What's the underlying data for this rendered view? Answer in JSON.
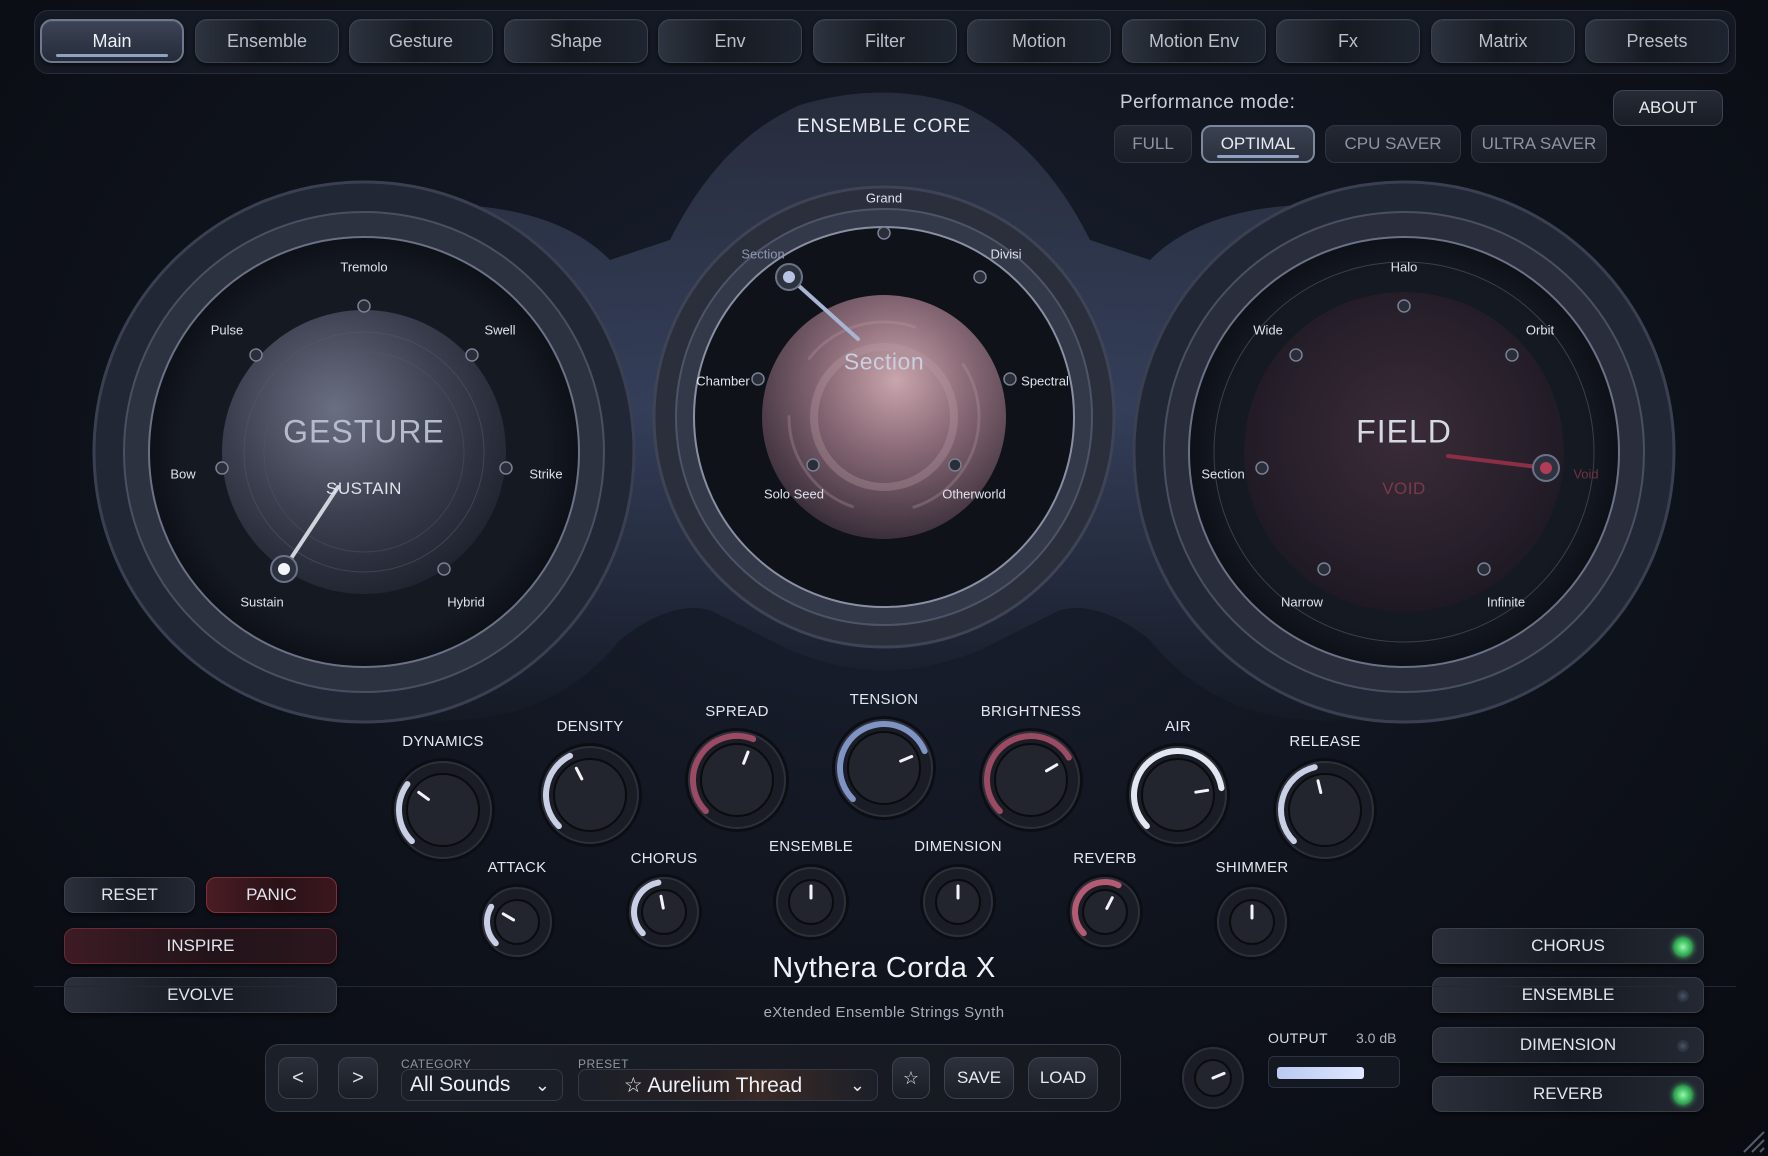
{
  "tabs": [
    "Main",
    "Ensemble",
    "Gesture",
    "Shape",
    "Env",
    "Filter",
    "Motion",
    "Motion Env",
    "Fx",
    "Matrix",
    "Presets"
  ],
  "active_tab": "Main",
  "performance": {
    "label": "Performance mode:",
    "modes": [
      "FULL",
      "OPTIMAL",
      "CPU SAVER",
      "ULTRA SAVER"
    ],
    "selected": "OPTIMAL"
  },
  "about_label": "ABOUT",
  "gesture_dial": {
    "title": "GESTURE",
    "value": "SUSTAIN",
    "positions": [
      "Tremolo",
      "Swell",
      "Strike",
      "Hybrid",
      "Sustain",
      "Bow",
      "Pulse"
    ],
    "selected": "Sustain"
  },
  "core_dial": {
    "header": "ENSEMBLE CORE",
    "value": "Section",
    "positions": [
      "Grand",
      "Divisi",
      "Spectral",
      "Otherworld",
      "Solo Seed",
      "Chamber",
      "Section"
    ],
    "selected": "Section"
  },
  "field_dial": {
    "title": "FIELD",
    "value": "VOID",
    "positions": [
      "Halo",
      "Orbit",
      "Void",
      "Infinite",
      "Narrow",
      "Section",
      "Wide"
    ],
    "selected": "Void"
  },
  "macro_knobs": [
    {
      "label": "DYNAMICS",
      "value": 0.3
    },
    {
      "label": "DENSITY",
      "value": 0.4
    },
    {
      "label": "SPREAD",
      "value": 0.58
    },
    {
      "label": "TENSION",
      "value": 0.75
    },
    {
      "label": "BRIGHTNESS",
      "value": 0.72
    },
    {
      "label": "AIR",
      "value": 0.8
    },
    {
      "label": "RELEASE",
      "value": 0.45
    }
  ],
  "fx_knobs": [
    {
      "label": "ATTACK",
      "value": 0.28
    },
    {
      "label": "CHORUS",
      "value": 0.46
    },
    {
      "label": "ENSEMBLE",
      "value": 0.5
    },
    {
      "label": "DIMENSION",
      "value": 0.5
    },
    {
      "label": "REVERB",
      "value": 0.6
    },
    {
      "label": "SHIMMER",
      "value": 0.5
    }
  ],
  "left_buttons": {
    "reset": "RESET",
    "panic": "PANIC",
    "inspire": "INSPIRE",
    "evolve": "EVOLVE"
  },
  "fx_toggles": [
    {
      "label": "CHORUS",
      "on": true
    },
    {
      "label": "ENSEMBLE",
      "on": false
    },
    {
      "label": "DIMENSION",
      "on": false
    },
    {
      "label": "REVERB",
      "on": true
    }
  ],
  "synth": {
    "name": "Nythera Corda X",
    "subtitle": "eXtended Ensemble Strings Synth"
  },
  "preset_bar": {
    "prev": "<",
    "next": ">",
    "category_caption": "CATEGORY",
    "category": "All Sounds",
    "preset_caption": "PRESET",
    "preset": "☆ Aurelium Thread",
    "favorite": "☆",
    "save": "SAVE",
    "load": "LOAD"
  },
  "output": {
    "label": "OUTPUT",
    "db": "3.0 dB",
    "level": 0.75
  },
  "colors": {
    "accent_blue": "#8fa2c6",
    "accent_red": "#b44a5e",
    "led_green": "#3fbf62"
  }
}
